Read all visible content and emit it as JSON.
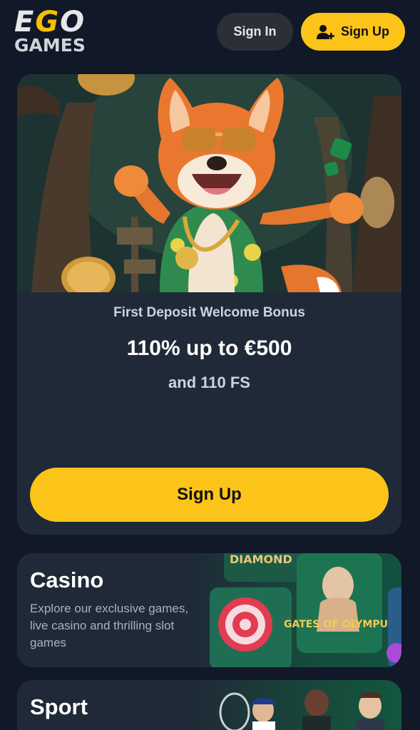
{
  "header": {
    "logo_top": "EGO",
    "logo_bottom": "GAMES",
    "sign_in_label": "Sign In",
    "sign_up_label": "Sign Up"
  },
  "bonus": {
    "subtitle": "First Deposit Welcome Bonus",
    "amount": "110% up to €500",
    "free_spins": "and 110 FS",
    "cta_label": "Sign Up"
  },
  "casino": {
    "title": "Casino",
    "description": "Explore our exclusive games, live casino and thrilling slot games",
    "game_tiles": [
      "DIAMOND",
      "GATES OF OLYMPUS"
    ]
  },
  "sport": {
    "title": "Sport"
  },
  "colors": {
    "background": "#111827",
    "card": "#1f2937",
    "accent": "#fcc419",
    "secondary_button": "#2b3038"
  }
}
